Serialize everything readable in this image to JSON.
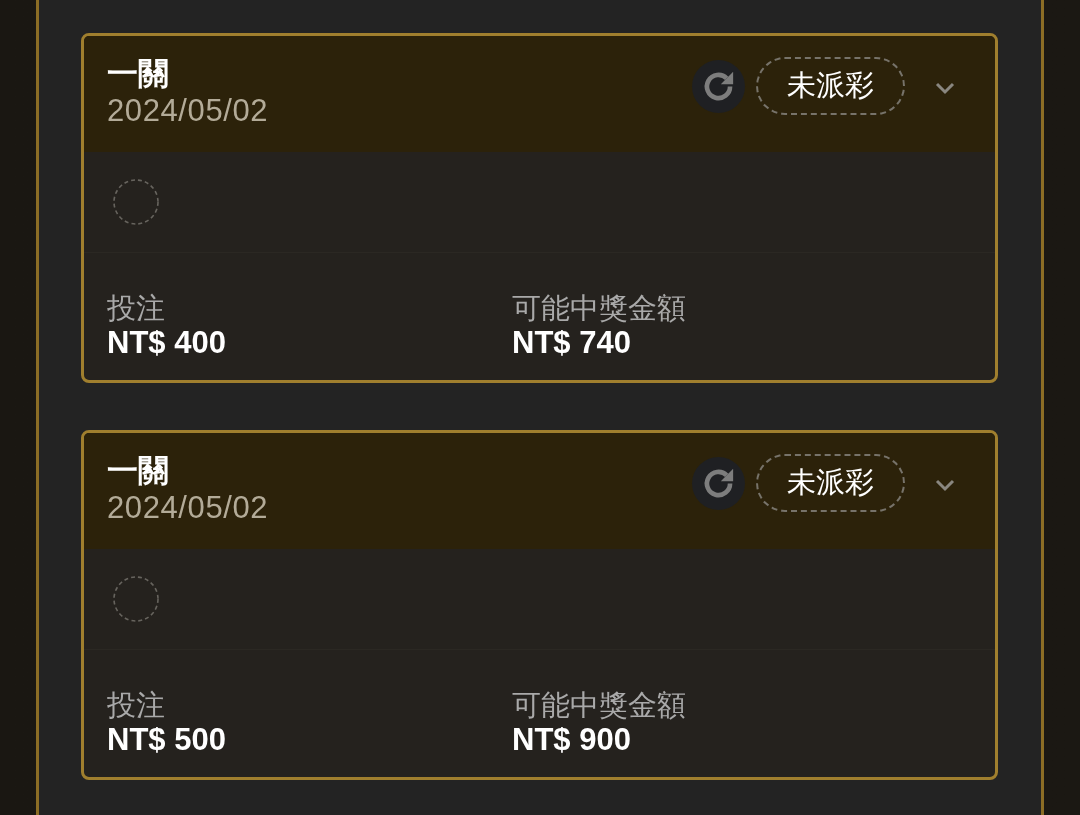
{
  "bets": [
    {
      "title": "一關",
      "date": "2024/05/02",
      "status": "未派彩",
      "stake": {
        "label": "投注",
        "value": "NT$ 400"
      },
      "payout": {
        "label": "可能中獎金額",
        "value": "NT$ 740"
      }
    },
    {
      "title": "一關",
      "date": "2024/05/02",
      "status": "未派彩",
      "stake": {
        "label": "投注",
        "value": "NT$ 500"
      },
      "payout": {
        "label": "可能中獎金額",
        "value": "NT$ 900"
      }
    }
  ]
}
